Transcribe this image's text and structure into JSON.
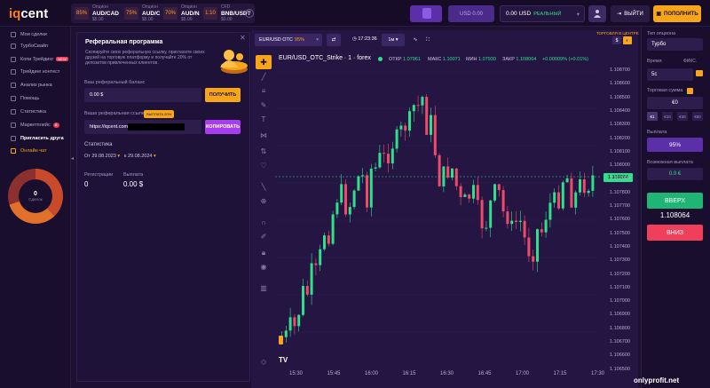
{
  "header": {
    "logo_mark": "iq",
    "logo_text": "cent",
    "assets": [
      {
        "top": "Опцион",
        "pct": "85%",
        "name": "AUD/CAD OTC",
        "sub": "$5.00"
      },
      {
        "top": "Опцион",
        "pct": "75%",
        "name": "AUD/CHF",
        "sub": "$5.00"
      },
      {
        "top": "Опцион",
        "pct": "70%",
        "name": "AUD/NZD",
        "sub": "$5.00"
      },
      {
        "top": "CFD",
        "pct": "1:10",
        "name": "BNB/USDT",
        "sub": "$0.00"
      }
    ],
    "small_balance": "USD 0.00",
    "balance": "0.00 USD",
    "balance_type": "РЕАЛЬНЫЙ",
    "logout": "ВЫЙТИ",
    "topup": "ПОПОЛНИТЬ"
  },
  "sidebar": {
    "items": [
      {
        "label": "Мои сделки"
      },
      {
        "label": "ТурбоСвайп"
      },
      {
        "label": "Копи Трейдинг",
        "badge": "NEW"
      },
      {
        "label": "Трейдинг контест"
      },
      {
        "label": "Анализ рынка"
      },
      {
        "label": "Помощь"
      },
      {
        "label": "Статистика"
      },
      {
        "label": "Маркетплейс",
        "badge": "8"
      },
      {
        "label": "Пригласить друга"
      },
      {
        "label": "Онлайн чат"
      }
    ],
    "donut_value": "0",
    "donut_label": "Сделок"
  },
  "referral": {
    "title": "Реферальная программа",
    "desc": "Скопируйте свою реферальную ссылку, пригласите своих друзей на торговую платформу и получайте 20% от депозитов привлеченных клиентов.",
    "balance_label": "Ваш реферальный баланс",
    "balance_value": "0.00 $",
    "get_btn": "ПОЛУЧИТЬ",
    "link_label": "Ваша реферальная ссылка",
    "pill": "ВЫПЛАТА 20%",
    "link_value": "https://iqcent.com/r/",
    "copy_btn": "КОПИРОВАТЬ",
    "stats_title": "Статистика",
    "date_from_prefix": "От",
    "date_from": "29.08.2023",
    "date_to_prefix": "к",
    "date_to": "29.08.2024",
    "reg_label": "Регистрации",
    "reg_value": "0",
    "pay_label": "Выплата",
    "pay_value": "0.00 $"
  },
  "chart": {
    "asset_sel": "EUR/USD OTC",
    "asset_pct": "95%",
    "clock": "17:23:36",
    "timeframe": "1м",
    "trade_center": "ТОРГОВЛЯ В ЦЕНТРЕ",
    "dollar": "$",
    "title": "EUR/USD_OTC_Strike · 1 · forex",
    "open_k": "ОТКР",
    "open_v": "1.07961",
    "high_k": "МАКС",
    "high_v": "1.10071",
    "low_k": "МИН",
    "low_v": "1.07930",
    "close_k": "ЗАКР",
    "close_v": "1.108064",
    "change_v": "+0.00009% (+0.01%)",
    "current_price": "1.108064",
    "tv": "TV",
    "price_labels": [
      "1.108800",
      "1.108600",
      "1.108400",
      "1.108200",
      "1.108000",
      "1.107800",
      "1.107600",
      "1.107400",
      "1.107200",
      "1.107000",
      "1.106800",
      "1.106600",
      "1.106400",
      "1.106200",
      "1.106000",
      "1.105800",
      "1.105600",
      "1.105400",
      "1.105200",
      "1.105000"
    ],
    "prices_disp": [
      "1.108700",
      "1.108600",
      "1.108500",
      "1.108400",
      "1.108300",
      "1.108200",
      "1.108100",
      "1.108000",
      "1.107900",
      "1.107800",
      "1.107700",
      "1.107600",
      "1.107500",
      "1.107400",
      "1.107300",
      "1.107200",
      "1.107100",
      "1.107000",
      "1.106900",
      "1.106800",
      "1.106700",
      "1.106600",
      "1.106500"
    ],
    "times": [
      "15:30",
      "15:45",
      "16:00",
      "16:15",
      "16:30",
      "16:45",
      "17:00",
      "17:15",
      "17:30"
    ]
  },
  "right": {
    "type_label": "Тип опциона",
    "type_value": "Турбо",
    "time_label": "Время",
    "time_mode": "ФИКС.",
    "time_value": "5с",
    "amount_label": "Торговая сумма",
    "amount_value": "€0",
    "amount_btns": [
      "€1",
      "€10",
      "€30",
      "€50"
    ],
    "payout_label": "Выплата",
    "payout_value": "95%",
    "reward_label": "Возможная выплата",
    "reward_value": "0.0 €",
    "up": "ВВЕРХ",
    "price": "1.108064",
    "down": "ВНИЗ"
  },
  "colors": {
    "up": "#1fb575",
    "down": "#ef3f5a",
    "accent": "#f7a61a",
    "bg": "#1d1033"
  },
  "watermark": "onlyprofit.net"
}
